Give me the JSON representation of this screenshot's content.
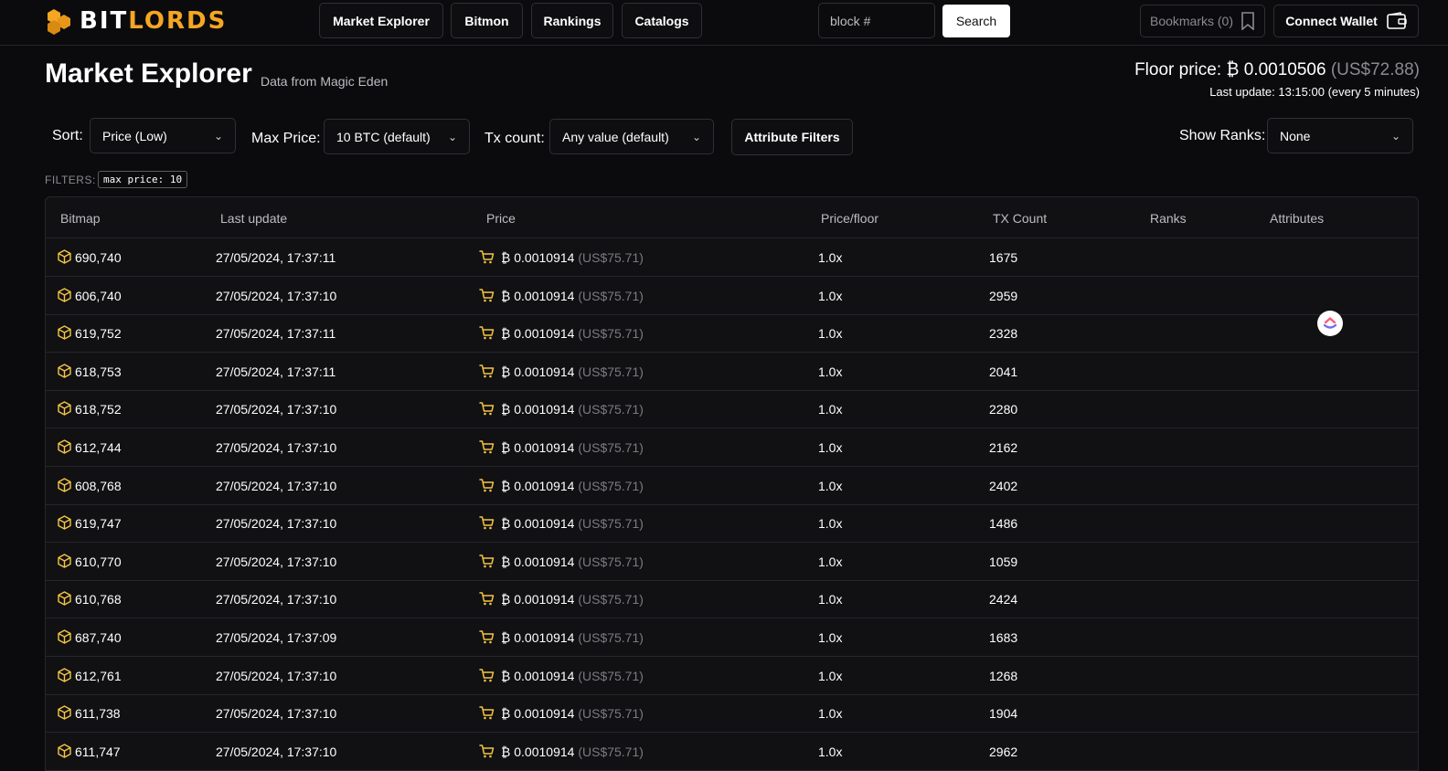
{
  "brand": {
    "logo_white": "BIT",
    "logo_yellow": "LORDS",
    "accent": "#f5a623"
  },
  "nav": {
    "items": [
      {
        "label": "Market Explorer"
      },
      {
        "label": "Bitmon"
      },
      {
        "label": "Rankings"
      },
      {
        "label": "Catalogs"
      }
    ],
    "search_placeholder": "block #",
    "search_button": "Search",
    "bookmarks": "Bookmarks (0)",
    "connect_wallet": "Connect Wallet"
  },
  "header": {
    "title": "Market Explorer",
    "subtitle": "Data from Magic Eden",
    "floor_label": "Floor price: ₿ 0.0010506",
    "floor_usd": "(US$72.88)",
    "last_update": "Last update: 13:15:00 (every 5 minutes)"
  },
  "controls": {
    "sort_label": "Sort:",
    "sort_value": "Price (Low)",
    "max_price_label": "Max Price:",
    "max_price_value": "10 BTC (default)",
    "tx_label": "Tx count:",
    "tx_value": "Any value (default)",
    "attribute_filters": "Attribute Filters",
    "show_ranks_label": "Show Ranks:",
    "show_ranks_value": "None",
    "filters_label": "FILTERS:",
    "filter_chip": "max price: 10"
  },
  "table": {
    "columns": [
      "Bitmap",
      "Last update",
      "Price",
      "Price/floor",
      "TX Count",
      "Ranks",
      "Attributes"
    ],
    "rows": [
      {
        "bitmap": "690,740",
        "updated": "27/05/2024, 17:37:11",
        "price": "₿ 0.0010914",
        "usd": "(US$75.71)",
        "ratio": "1.0x",
        "tx": "1675"
      },
      {
        "bitmap": "606,740",
        "updated": "27/05/2024, 17:37:10",
        "price": "₿ 0.0010914",
        "usd": "(US$75.71)",
        "ratio": "1.0x",
        "tx": "2959"
      },
      {
        "bitmap": "619,752",
        "updated": "27/05/2024, 17:37:11",
        "price": "₿ 0.0010914",
        "usd": "(US$75.71)",
        "ratio": "1.0x",
        "tx": "2328"
      },
      {
        "bitmap": "618,753",
        "updated": "27/05/2024, 17:37:11",
        "price": "₿ 0.0010914",
        "usd": "(US$75.71)",
        "ratio": "1.0x",
        "tx": "2041"
      },
      {
        "bitmap": "618,752",
        "updated": "27/05/2024, 17:37:10",
        "price": "₿ 0.0010914",
        "usd": "(US$75.71)",
        "ratio": "1.0x",
        "tx": "2280"
      },
      {
        "bitmap": "612,744",
        "updated": "27/05/2024, 17:37:10",
        "price": "₿ 0.0010914",
        "usd": "(US$75.71)",
        "ratio": "1.0x",
        "tx": "2162"
      },
      {
        "bitmap": "608,768",
        "updated": "27/05/2024, 17:37:10",
        "price": "₿ 0.0010914",
        "usd": "(US$75.71)",
        "ratio": "1.0x",
        "tx": "2402"
      },
      {
        "bitmap": "619,747",
        "updated": "27/05/2024, 17:37:10",
        "price": "₿ 0.0010914",
        "usd": "(US$75.71)",
        "ratio": "1.0x",
        "tx": "1486"
      },
      {
        "bitmap": "610,770",
        "updated": "27/05/2024, 17:37:10",
        "price": "₿ 0.0010914",
        "usd": "(US$75.71)",
        "ratio": "1.0x",
        "tx": "1059"
      },
      {
        "bitmap": "610,768",
        "updated": "27/05/2024, 17:37:10",
        "price": "₿ 0.0010914",
        "usd": "(US$75.71)",
        "ratio": "1.0x",
        "tx": "2424"
      },
      {
        "bitmap": "687,740",
        "updated": "27/05/2024, 17:37:09",
        "price": "₿ 0.0010914",
        "usd": "(US$75.71)",
        "ratio": "1.0x",
        "tx": "1683"
      },
      {
        "bitmap": "612,761",
        "updated": "27/05/2024, 17:37:10",
        "price": "₿ 0.0010914",
        "usd": "(US$75.71)",
        "ratio": "1.0x",
        "tx": "1268"
      },
      {
        "bitmap": "611,738",
        "updated": "27/05/2024, 17:37:10",
        "price": "₿ 0.0010914",
        "usd": "(US$75.71)",
        "ratio": "1.0x",
        "tx": "1904"
      },
      {
        "bitmap": "611,747",
        "updated": "27/05/2024, 17:37:10",
        "price": "₿ 0.0010914",
        "usd": "(US$75.71)",
        "ratio": "1.0x",
        "tx": "2962"
      }
    ]
  }
}
